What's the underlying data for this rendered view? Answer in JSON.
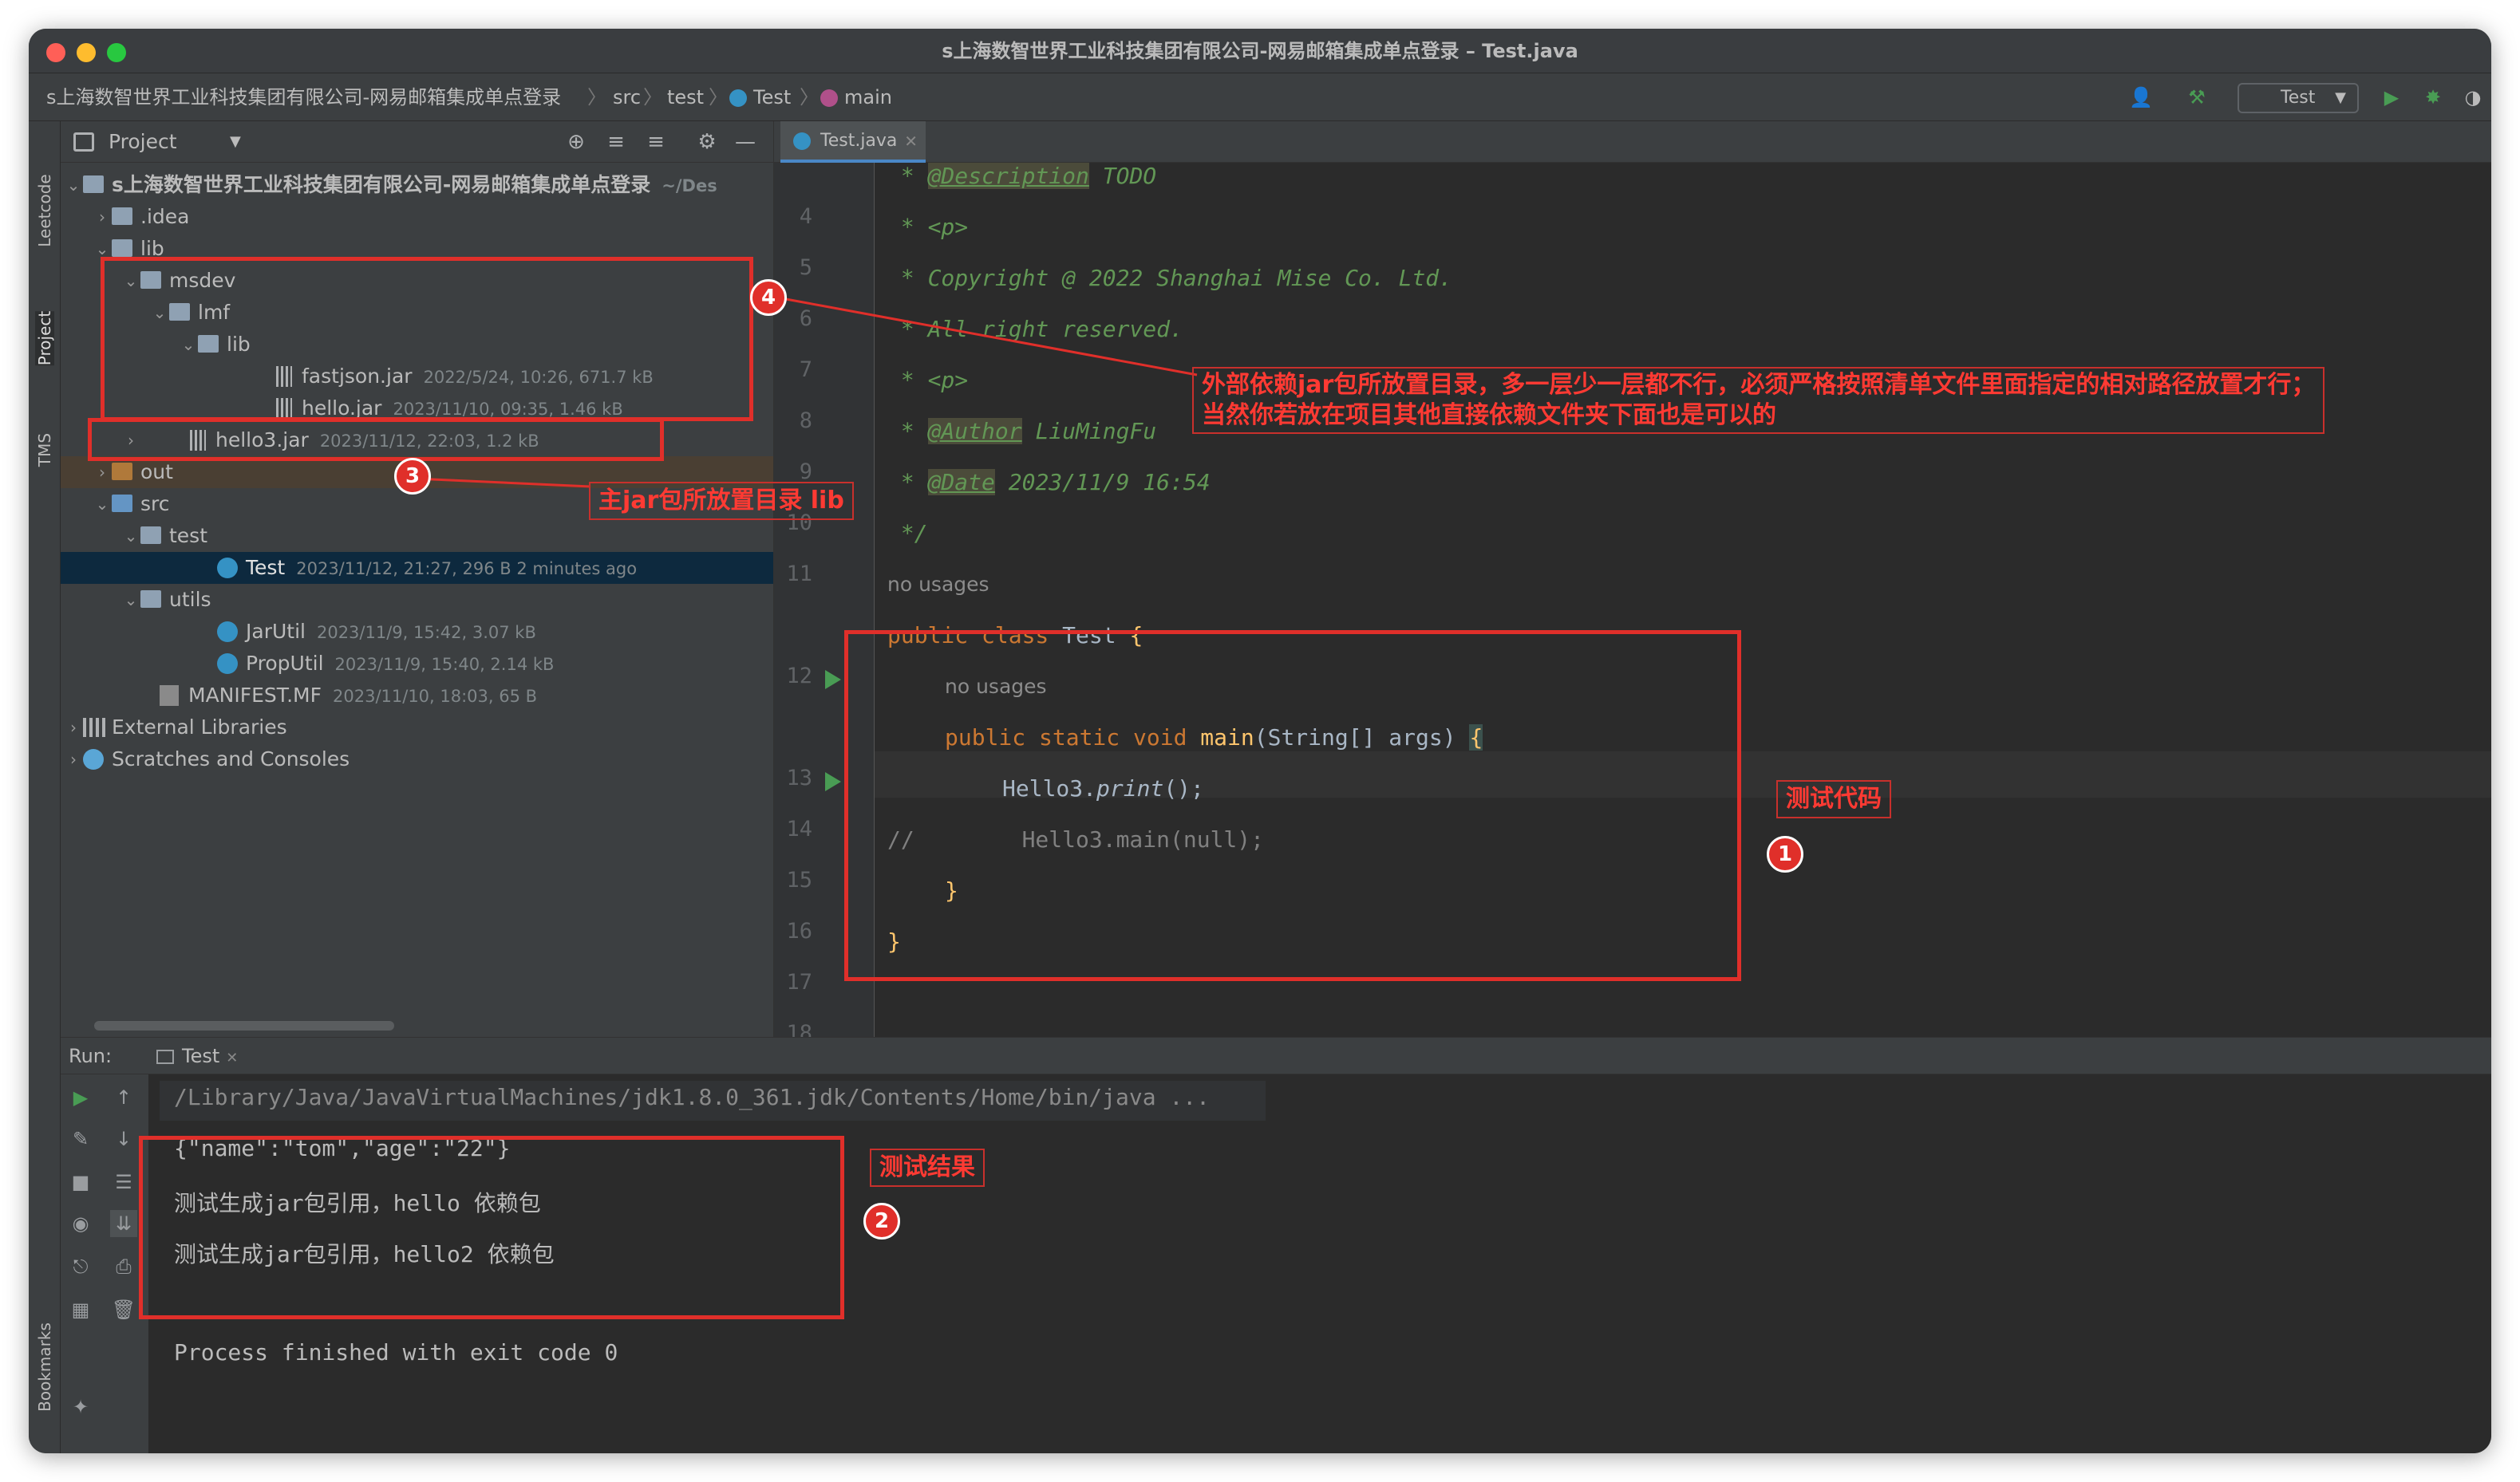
{
  "window": {
    "title": "s上海数智世界工业科技集团有限公司-网易邮箱集成单点登录 – Test.java"
  },
  "breadcrumb": {
    "project": "s上海数智世界工业科技集团有限公司-网易邮箱集成单点登录",
    "src": "src",
    "test": "test",
    "cls": "Test",
    "method": "main"
  },
  "toolbar": {
    "run_config": "Test"
  },
  "side_tabs": {
    "leetcode": "Leetcode",
    "project": "Project",
    "tms": "TMS",
    "bookmarks": "Bookmarks"
  },
  "project_panel": {
    "title": "Project",
    "tree": [
      {
        "name": "s上海数智世界工业科技集团有限公司-网易邮箱集成单点登录",
        "meta": "~/Des"
      },
      {
        "name": ".idea",
        "meta": ""
      },
      {
        "name": "lib",
        "meta": ""
      },
      {
        "name": "msdev",
        "meta": ""
      },
      {
        "name": "lmf",
        "meta": ""
      },
      {
        "name": "lib",
        "meta": ""
      },
      {
        "name": "fastjson.jar",
        "meta": "2022/5/24, 10:26, 671.7 kB"
      },
      {
        "name": "hello.jar",
        "meta": "2023/11/10, 09:35, 1.46 kB"
      },
      {
        "name": "hello3.jar",
        "meta": "2023/11/12, 22:03, 1.2 kB"
      },
      {
        "name": "out",
        "meta": ""
      },
      {
        "name": "src",
        "meta": ""
      },
      {
        "name": "test",
        "meta": ""
      },
      {
        "name": "Test",
        "meta": "2023/11/12, 21:27, 296 B 2 minutes ago"
      },
      {
        "name": "utils",
        "meta": ""
      },
      {
        "name": "JarUtil",
        "meta": "2023/11/9, 15:42, 3.07 kB"
      },
      {
        "name": "PropUtil",
        "meta": "2023/11/9, 15:40, 2.14 kB"
      },
      {
        "name": "MANIFEST.MF",
        "meta": "2023/11/10, 18:03, 65 B"
      },
      {
        "name": "External Libraries",
        "meta": ""
      },
      {
        "name": "Scratches and Consoles",
        "meta": ""
      }
    ]
  },
  "editor": {
    "tab": "Test.java",
    "line_numbers": [
      "4",
      "5",
      "6",
      "7",
      "8",
      "9",
      "10",
      "11",
      "12",
      "13",
      "14",
      "15",
      "16",
      "17",
      "18"
    ],
    "code": {
      "l4_star": " * ",
      "l4_tag": "@Description",
      "l4_rest": " TODO",
      "l5": " * <p>",
      "l6": " * Copyright @ 2022 Shanghai Mise Co. Ltd.",
      "l7": " * All right reserved.",
      "l8": " * <p>",
      "l9_star": " * ",
      "l9_tag": "@Author",
      "l9_rest": " LiuMingFu",
      "l10_star": " * ",
      "l10_tag": "@Date",
      "l10_rest": " 2023/11/9 16:54",
      "l11": " */",
      "hint_class": "no usages",
      "l12_kw": "public class ",
      "l12_name": "Test",
      "l12_brace": " {",
      "hint_main": "no usages",
      "l13_kw": "public static void ",
      "l13_fn": "main",
      "l13_params": "(String[] args) ",
      "l13_brace": "{",
      "l14_a": "Hello3.",
      "l14_b": "print",
      "l14_c": "();",
      "l15": "//        Hello3.main(null);",
      "l16": "}",
      "l17": "}"
    }
  },
  "run": {
    "label": "Run:",
    "tab": "Test",
    "command": "/Library/Java/JavaVirtualMachines/jdk1.8.0_361.jdk/Contents/Home/bin/java ...",
    "lines": [
      "{\"name\":\"tom\",\"age\":\"22\"}",
      "测试生成jar包引用，hello 依赖包",
      "测试生成jar包引用，hello2 依赖包"
    ],
    "exit": "Process finished with exit code 0"
  },
  "annotations": {
    "note1": "测试代码",
    "note2": "测试结果",
    "note3": "主jar包所放置目录 lib",
    "note4_line1": "外部依赖jar包所放置目录，多一层少一层都不行，必须严格按照清单文件里面指定的相对路径放置才行；",
    "note4_line2": "当然你若放在项目其他直接依赖文件夹下面也是可以的",
    "badge1": "1",
    "badge2": "2",
    "badge3": "3",
    "badge4": "4"
  },
  "colors": {
    "accent_red": "#e02f2a",
    "editor_bg": "#2b2b2b",
    "panel_bg": "#3c3f41"
  }
}
